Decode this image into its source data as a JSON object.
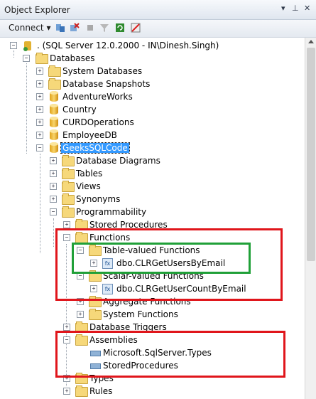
{
  "window": {
    "title": "Object Explorer",
    "pin_icon": "pin-icon",
    "close_icon": "close-icon"
  },
  "toolbar": {
    "connect_label": "Connect"
  },
  "tree": {
    "server": ". (SQL Server 12.0.2000 - IN\\Dinesh.Singh)",
    "databases": "Databases",
    "system_databases": "System Databases",
    "database_snapshots": "Database Snapshots",
    "db_adventureworks": "AdventureWorks",
    "db_country": "Country",
    "db_curd": "CURDOperations",
    "db_employee": "EmployeeDB",
    "db_geeks": "GeeksSQLCode",
    "database_diagrams": "Database Diagrams",
    "tables": "Tables",
    "views": "Views",
    "synonyms": "Synonyms",
    "programmability": "Programmability",
    "stored_procedures": "Stored Procedures",
    "functions": "Functions",
    "table_valued": "Table-valued Functions",
    "fn_get_users": "dbo.CLRGetUsersByEmail",
    "scalar_valued": "Scalar-valued Functions",
    "fn_get_count": "dbo.CLRGetUserCountByEmail",
    "aggregate": "Aggregate Functions",
    "system_functions": "System Functions",
    "database_triggers": "Database Triggers",
    "assemblies": "Assemblies",
    "asm_sqlserver_types": "Microsoft.SqlServer.Types",
    "asm_storedprocedures": "StoredProcedures",
    "types": "Types",
    "rules": "Rules"
  },
  "colors": {
    "highlight_red": "#e0151b",
    "highlight_green": "#20a038",
    "selection": "#3399ff"
  }
}
